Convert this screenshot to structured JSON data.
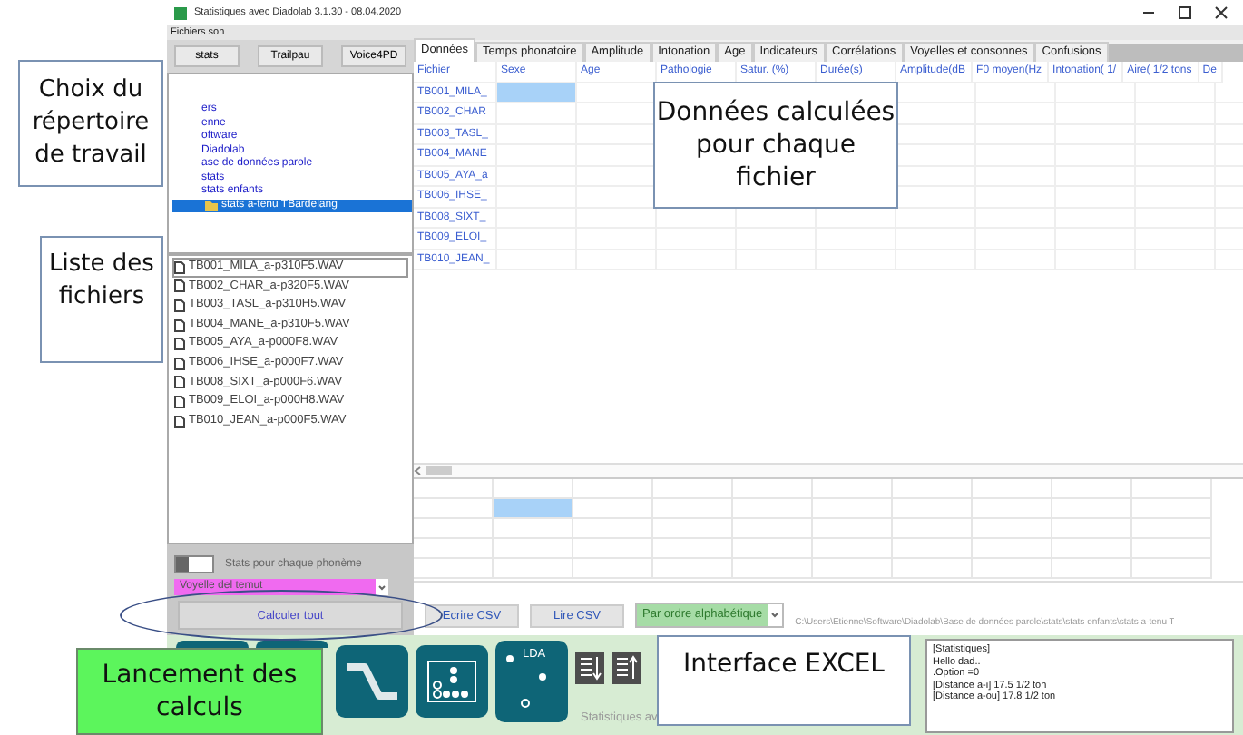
{
  "window": {
    "title": "Statistiques avec Diadolab 3.1.30 - 08.04.2020"
  },
  "menu": [
    "Fichiers son"
  ],
  "source_buttons": [
    "stats",
    "Trailpau",
    "Voice4PD"
  ],
  "folders": [
    {
      "label": "ers",
      "selected": false
    },
    {
      "label": "enne",
      "selected": false
    },
    {
      "label": "oftware",
      "selected": false
    },
    {
      "label": "Diadolab",
      "selected": false
    },
    {
      "label": "ase de données parole",
      "selected": false
    },
    {
      "label": "stats",
      "selected": false
    },
    {
      "label": "stats enfants",
      "selected": false
    },
    {
      "label": "stats a-tenu TBardelang",
      "selected": true
    }
  ],
  "files": [
    {
      "name": "TB001_MILA_a-p310F5.WAV",
      "selected": true
    },
    {
      "name": "TB002_CHAR_a-p320F5.WAV",
      "selected": false
    },
    {
      "name": "TB003_TASL_a-p310H5.WAV",
      "selected": false
    },
    {
      "name": "TB004_MANE_a-p310F5.WAV",
      "selected": false
    },
    {
      "name": "TB005_AYA_a-p000F8.WAV",
      "selected": false
    },
    {
      "name": "TB006_IHSE_a-p000F7.WAV",
      "selected": false
    },
    {
      "name": "TB008_SIXT_a-p000F6.WAV",
      "selected": false
    },
    {
      "name": "TB009_ELOI_a-p000H8.WAV",
      "selected": false
    },
    {
      "name": "TB010_JEAN_a-p000F5.WAV",
      "selected": false
    }
  ],
  "phoneme_stats": {
    "label": "Stats pour chaque phonème",
    "on": false
  },
  "phoneme_select": {
    "value": "Voyelle del temut"
  },
  "calculate_button": "Calculer tout",
  "tabs": [
    {
      "label": "Données",
      "selected": true
    },
    {
      "label": "Temps phonatoire",
      "selected": false
    },
    {
      "label": "Amplitude",
      "selected": false
    },
    {
      "label": "Intonation",
      "selected": false
    },
    {
      "label": "Age",
      "selected": false
    },
    {
      "label": "Indicateurs",
      "selected": false
    },
    {
      "label": "Corrélations",
      "selected": false
    },
    {
      "label": "Voyelles et consonnes",
      "selected": false
    },
    {
      "label": "Confusions",
      "selected": false
    }
  ],
  "table": {
    "columns": [
      "Fichier",
      "Sexe",
      "Age",
      "Pathologie",
      "Satur. (%)",
      "Durée(s)",
      "Amplitude(dB",
      "F0 moyen(Hz",
      "Intonation( 1/",
      "Aire( 1/2 tons",
      "De"
    ],
    "rows": [
      {
        "file": "TB001_MILA_",
        "selected": true
      },
      {
        "file": "TB002_CHAR",
        "selected": false
      },
      {
        "file": "TB003_TASL_",
        "selected": false
      },
      {
        "file": "TB004_MANE",
        "selected": false
      },
      {
        "file": "TB005_AYA_a",
        "selected": false
      },
      {
        "file": "TB006_IHSE_",
        "selected": false
      },
      {
        "file": "TB008_SIXT_",
        "selected": false
      },
      {
        "file": "TB009_ELOI_",
        "selected": false
      },
      {
        "file": "TB010_JEAN_",
        "selected": false
      }
    ]
  },
  "summary_grid": {
    "rows": [
      {
        "cells": [
          {
            "selected": false
          },
          {
            "selected": false
          },
          {
            "selected": false
          },
          {
            "selected": false
          },
          {
            "selected": false
          },
          {
            "selected": false
          },
          {
            "selected": false
          },
          {
            "selected": false
          },
          {
            "selected": false
          },
          {
            "selected": false
          }
        ]
      },
      {
        "cells": [
          {
            "selected": false
          },
          {
            "selected": true
          },
          {
            "selected": false
          },
          {
            "selected": false
          },
          {
            "selected": false
          },
          {
            "selected": false
          },
          {
            "selected": false
          },
          {
            "selected": false
          },
          {
            "selected": false
          },
          {
            "selected": false
          }
        ]
      },
      {
        "cells": [
          {
            "selected": false
          },
          {
            "selected": false
          },
          {
            "selected": false
          },
          {
            "selected": false
          },
          {
            "selected": false
          },
          {
            "selected": false
          },
          {
            "selected": false
          },
          {
            "selected": false
          },
          {
            "selected": false
          },
          {
            "selected": false
          }
        ]
      },
      {
        "cells": [
          {
            "selected": false
          },
          {
            "selected": false
          },
          {
            "selected": false
          },
          {
            "selected": false
          },
          {
            "selected": false
          },
          {
            "selected": false
          },
          {
            "selected": false
          },
          {
            "selected": false
          },
          {
            "selected": false
          },
          {
            "selected": false
          }
        ]
      },
      {
        "cells": [
          {
            "selected": false
          },
          {
            "selected": false
          },
          {
            "selected": false
          },
          {
            "selected": false
          },
          {
            "selected": false
          },
          {
            "selected": false
          },
          {
            "selected": false
          },
          {
            "selected": false
          },
          {
            "selected": false
          },
          {
            "selected": false
          }
        ]
      }
    ]
  },
  "csv_buttons": [
    "Ecrire CSV",
    "Lire CSV"
  ],
  "sort_select": {
    "value": "Par ordre alphabétique"
  },
  "path": "C:\\Users\\Etienne\\Software\\Diadolab\\Base de données parole\\stats\\stats enfants\\stats a-tenu T",
  "toolbar": {
    "tools": [
      {
        "kind": "blank"
      },
      {
        "kind": "blank"
      },
      {
        "kind": "curve"
      },
      {
        "kind": "dots"
      },
      {
        "kind": "lda",
        "label": "LDA"
      },
      {
        "kind": "sort-down"
      },
      {
        "kind": "sort-up"
      }
    ],
    "caption": "Statistiques av"
  },
  "log": [
    "[Statistiques]",
    "Hello dad..",
    ".Option =0",
    "[Distance a-i] 17.5 1/2 ton",
    "[Distance a-ou] 17.8 1/2 ton"
  ],
  "annotations": [
    {
      "kind": "box",
      "text": "Choix du répertoire de travail"
    },
    {
      "kind": "box",
      "text": "Liste des fichiers"
    },
    {
      "kind": "box",
      "text": "Données calculées pour chaque fichier"
    },
    {
      "kind": "green",
      "text": "Lancement des calculs"
    },
    {
      "kind": "box",
      "text": "Interface EXCEL"
    },
    {
      "kind": "ellipse"
    }
  ]
}
